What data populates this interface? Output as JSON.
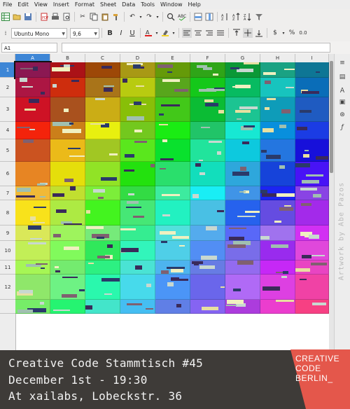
{
  "menu": [
    "File",
    "Edit",
    "View",
    "Insert",
    "Format",
    "Sheet",
    "Data",
    "Tools",
    "Window",
    "Help"
  ],
  "toolbar": {
    "font_name": "Ubuntu Mono",
    "font_size": "9,6",
    "bold": "B",
    "italic": "I",
    "underline": "U",
    "currency": "$",
    "percent": "%",
    "decimals": "0.0"
  },
  "namebox": "A1",
  "columns": [
    "A",
    "B",
    "C",
    "D",
    "E",
    "F",
    "G",
    "H",
    "I"
  ],
  "rows": [
    "1",
    "2",
    "3",
    "4",
    "5",
    "6",
    "7",
    "8",
    "9",
    "10",
    "11",
    "12"
  ],
  "artwork_credit": "Artwork by Abe Pazos",
  "event": {
    "line1": "Creative Code Stammtisch #45",
    "line2": "December 1st - 19:30",
    "line3": "At xailabs, Lobeckstr. 36"
  },
  "logo": {
    "line1": "CREATIVE",
    "line2": "CODE",
    "line3": "BERLIN_",
    "color": "#e4574b"
  },
  "colors": {
    "selection": "#3d86d6",
    "banner": "#3e3b38"
  }
}
